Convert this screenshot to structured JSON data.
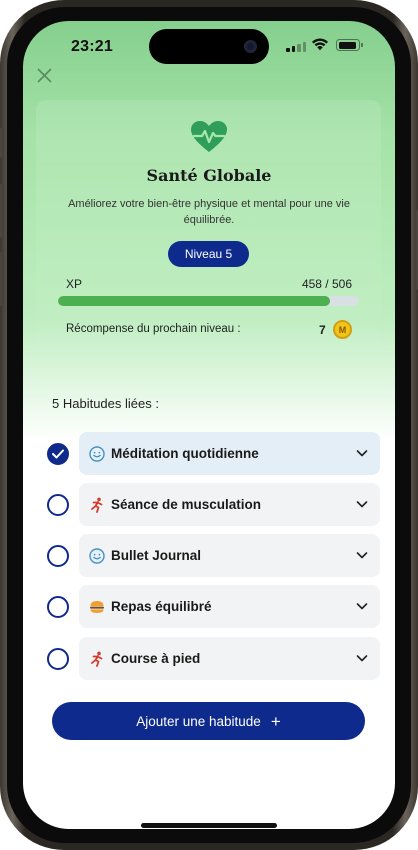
{
  "status_bar": {
    "time": "23:21"
  },
  "header": {
    "title": "Santé Globale",
    "subtitle": "Améliorez votre bien-être physique et mental pour une vie équilibrée.",
    "level_badge": "Niveau 5",
    "xp_label": "XP",
    "xp_value": "458 / 506",
    "xp_progress": 0.905,
    "reward_label": "Récompense du prochain niveau :",
    "reward_value": "7",
    "reward_icon": "coin-icon",
    "accent_color": "#4caf50"
  },
  "habits": {
    "heading": "5 Habitudes liées :",
    "items": [
      {
        "label": "Méditation quotidienne",
        "icon": "smile-icon",
        "checked": true
      },
      {
        "label": "Séance de musculation",
        "icon": "running-icon",
        "checked": false
      },
      {
        "label": "Bullet Journal",
        "icon": "smile-icon",
        "checked": false
      },
      {
        "label": "Repas équilibré",
        "icon": "burger-icon",
        "checked": false
      },
      {
        "label": "Course à pied",
        "icon": "running-icon",
        "checked": false
      }
    ]
  },
  "add_button": {
    "label": "Ajouter une habitude"
  },
  "colors": {
    "primary": "#0d2a8c",
    "progress": "#4caf50",
    "header_top": "#85cf8e"
  }
}
